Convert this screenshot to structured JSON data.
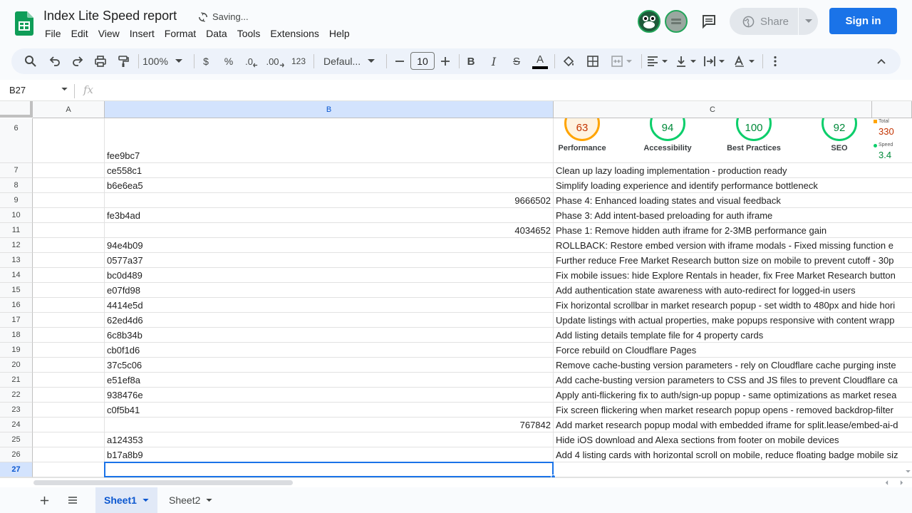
{
  "window": {
    "doc_title": "Index Lite Speed report",
    "status": "Saving..."
  },
  "menu": [
    "File",
    "Edit",
    "View",
    "Insert",
    "Format",
    "Data",
    "Tools",
    "Extensions",
    "Help"
  ],
  "header": {
    "share_label": "Share",
    "signin_label": "Sign in"
  },
  "toolbar": {
    "zoom": "100%",
    "currency": "$",
    "percent": "%",
    "dec_decrease": ".0",
    "dec_increase": ".00",
    "number_format": "123",
    "font": "Defaul...",
    "font_size": "10",
    "bold": "B",
    "italic": "I",
    "strike": "S",
    "text_color": "A"
  },
  "formula_bar": {
    "cell_ref": "B27",
    "fx": "fx",
    "value": ""
  },
  "columns": [
    "A",
    "B",
    "C"
  ],
  "selected_column": "B",
  "selected_row": "27",
  "lighthouse": {
    "scores": [
      {
        "value": "63",
        "label": "Performance",
        "status": "orange"
      },
      {
        "value": "94",
        "label": "Accessibility",
        "status": "green"
      },
      {
        "value": "100",
        "label": "Best Practices",
        "status": "green"
      },
      {
        "value": "92",
        "label": "SEO",
        "status": "green"
      }
    ],
    "side_metrics": [
      {
        "label": "Total",
        "value": "330"
      },
      {
        "label": "Speed",
        "value": "3.4"
      }
    ]
  },
  "rows": [
    {
      "num": "6",
      "b": "fee9bc7",
      "b_align": "left",
      "c": ""
    },
    {
      "num": "7",
      "b": "ce558c1",
      "b_align": "left",
      "c": "Clean up lazy loading implementation - production ready"
    },
    {
      "num": "8",
      "b": "b6e6ea5",
      "b_align": "left",
      "c": "Simplify loading experience and identify performance bottleneck"
    },
    {
      "num": "9",
      "b": "9666502",
      "b_align": "right",
      "c": "Phase 4: Enhanced loading states and visual feedback"
    },
    {
      "num": "10",
      "b": "fe3b4ad",
      "b_align": "left",
      "c": "Phase 3: Add intent-based preloading for auth iframe"
    },
    {
      "num": "11",
      "b": "4034652",
      "b_align": "right",
      "c": "Phase 1: Remove hidden auth iframe for 2-3MB performance gain"
    },
    {
      "num": "12",
      "b": "94e4b09",
      "b_align": "left",
      "c": "ROLLBACK: Restore embed version with iframe modals - Fixed missing function e"
    },
    {
      "num": "13",
      "b": "0577a37",
      "b_align": "left",
      "c": "Further reduce Free Market Research button size on mobile to prevent cutoff - 30p"
    },
    {
      "num": "14",
      "b": "bc0d489",
      "b_align": "left",
      "c": "Fix mobile issues: hide Explore Rentals in header, fix Free Market Research button"
    },
    {
      "num": "15",
      "b": "e07fd98",
      "b_align": "left",
      "c": "Add authentication state awareness with auto-redirect for logged-in users"
    },
    {
      "num": "16",
      "b": "4414e5d",
      "b_align": "left",
      "c": "Fix horizontal scrollbar in market research popup - set width to 480px and hide hori"
    },
    {
      "num": "17",
      "b": "62ed4d6",
      "b_align": "left",
      "c": "Update listings with actual properties, make popups responsive with content wrapp"
    },
    {
      "num": "18",
      "b": "6c8b34b",
      "b_align": "left",
      "c": "Add listing details template file for 4 property cards"
    },
    {
      "num": "19",
      "b": "cb0f1d6",
      "b_align": "left",
      "c": "Force rebuild on Cloudflare Pages"
    },
    {
      "num": "20",
      "b": "37c5c06",
      "b_align": "left",
      "c": "Remove cache-busting version parameters - rely on Cloudflare cache purging inste"
    },
    {
      "num": "21",
      "b": "e51ef8a",
      "b_align": "left",
      "c": "Add cache-busting version parameters to CSS and JS files to prevent Cloudflare ca"
    },
    {
      "num": "22",
      "b": "938476e",
      "b_align": "left",
      "c": "Apply anti-flickering fix to auth/sign-up popup - same optimizations as market resea"
    },
    {
      "num": "23",
      "b": "c0f5b41",
      "b_align": "left",
      "c": "Fix screen flickering when market research popup opens - removed backdrop-filter"
    },
    {
      "num": "24",
      "b": "767842",
      "b_align": "right",
      "c": "Add market research popup modal with embedded iframe for split.lease/embed-ai-d"
    },
    {
      "num": "25",
      "b": "a124353",
      "b_align": "left",
      "c": "Hide iOS download and Alexa sections from footer on mobile devices"
    },
    {
      "num": "26",
      "b": "b17a8b9",
      "b_align": "left",
      "c": "Add 4 listing cards with horizontal scroll on mobile, reduce floating badge mobile siz"
    },
    {
      "num": "27",
      "b": "",
      "b_align": "left",
      "c": ""
    }
  ],
  "sheets": [
    {
      "name": "Sheet1",
      "active": true
    },
    {
      "name": "Sheet2",
      "active": false
    }
  ],
  "colors": {
    "accent": "#1a73e8",
    "sheets_green": "#0f9d58",
    "selected_header": "#d3e3fd"
  }
}
